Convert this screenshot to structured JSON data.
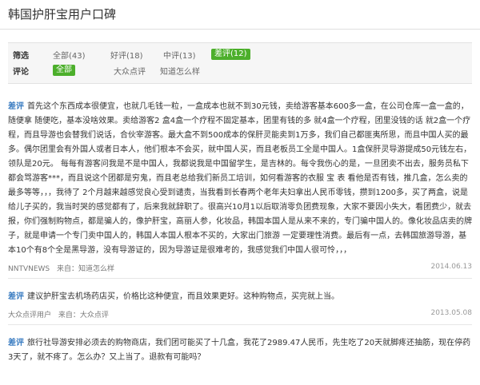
{
  "page_title": "韩国护肝宝用户口碑",
  "filters": {
    "filter_label": "筛选",
    "filter_options": [
      {
        "label": "全部",
        "count": "(43)",
        "selected": false
      },
      {
        "label": "好评",
        "count": "(18)",
        "selected": false
      },
      {
        "label": "中评",
        "count": "(13)",
        "selected": false
      },
      {
        "label": "差评",
        "count": "(12)",
        "selected": true
      }
    ],
    "review_label": "评论",
    "review_options": [
      {
        "label": "全部",
        "selected": true
      },
      {
        "label": "大众点评",
        "selected": false
      },
      {
        "label": "知道怎么样",
        "selected": false
      }
    ]
  },
  "reviews": [
    {
      "rating": "差评",
      "text": "首先这个东西成本很便宜，也就几毛钱一粒，一盒成本也就不到30元钱，卖给游客基本600多一盒，在公司仓库一盒一盒的，随便拿 随便吃，基本没啥效果。卖给游客2 盒4盒一个疗程不固定基本，团里有钱的多 就4盒一个疗程，团里没钱的话 就2盒一个疗程，而且导游也会替我们说话，合伙宰游客。最大盒不到500成本的保肝灵能卖到1万多，我们自己都匪夷所思，而且中国人买的最多。偶尔团里会有外国人或者日本人，他们根本不会买，就中国人买，而且老板员工全是中国人。1盒保肝灵导游提成50元钱左右，领队是20元。 每每有游客问我是不是中国人，我都说我是中国留学生，是吉林的。每令我伤心的是，一旦团卖不出去，服务员私下都会骂游客***，而且说这个团都是穷鬼，而且老总给我们新员工培训，如何看游客的衣服 宝 表 看他是否有钱，推几盒，怎么卖的最多等等，，，我待了 2个月越来越感觉良心受到谴责，当我看到长春两个老年夫妇拿出人民币零钱，攒到1200多，买了两盒，说是给儿子买的，我当时哭的感觉都有了，后来我就辞职了。很高兴10月1以后取消零负团费现象，大家不要因小失大，看团费少，就去报，你们强制购物点，都是骗人的，像护肝宝，高丽人参，化妆品，韩国本国人是从来不来的，专门骗中国人的。像化妆品店卖的牌子，就是申请一个专门卖中国人的，韩国人本国人根本不买的，大家出门旅游 一定要理性消费。最后有一点，去韩国旅游导游，基本10个有8个全是黑导游，没有导游证的，因为导游证是很难考的，我感觉我们中国人很可怜，，，",
      "source": "NNTVNEWS",
      "via": "来自：知道怎么样",
      "date": "2014.06.13"
    },
    {
      "rating": "差评",
      "text": "建议护肝宝去机场药店买，价格比这种便宜，而且效果更好。这种购物点，买完就上当。",
      "source": "大众点评用户",
      "via": "来自：大众点评",
      "date": "2013.05.08"
    },
    {
      "rating": "差评",
      "text": "旅行社导游安排必须去的购物商店，我们团可能买了十几盒，我花了2989.47人民币，先生吃了20天就脚疼还抽筋，现在停药3天了，就不疼了。怎么办？又上当了。退款有可能吗？",
      "source": "",
      "via": "",
      "date": ""
    }
  ]
}
